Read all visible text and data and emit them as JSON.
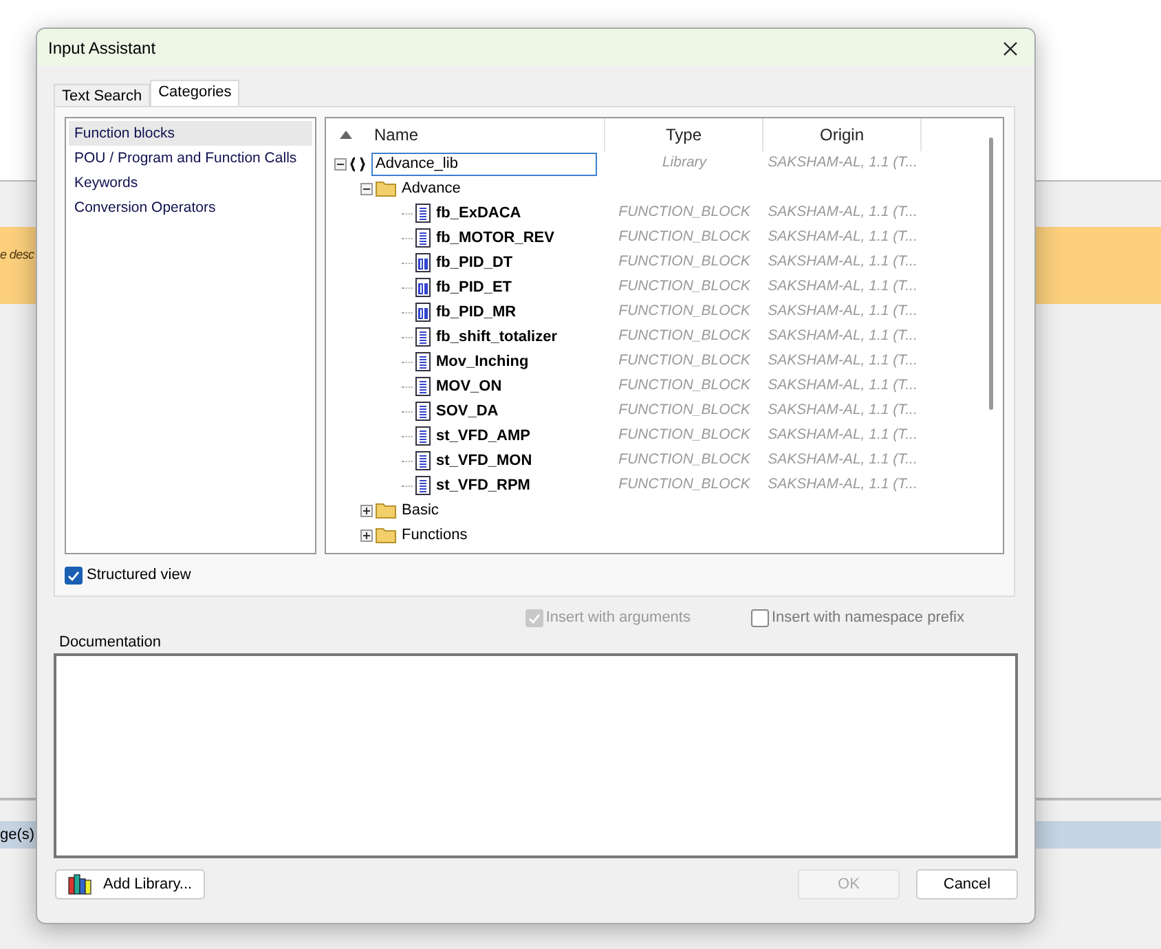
{
  "background": {
    "banner_text": "e desc",
    "status_text": "ge(s)"
  },
  "window": {
    "title": "Input Assistant"
  },
  "tabs": [
    {
      "label": "Text Search",
      "selected": false
    },
    {
      "label": "Categories",
      "selected": true
    }
  ],
  "categories": [
    {
      "label": "Function blocks",
      "selected": true
    },
    {
      "label": "POU / Program and Function Calls",
      "selected": false
    },
    {
      "label": "Keywords",
      "selected": false
    },
    {
      "label": "Conversion Operators",
      "selected": false
    }
  ],
  "tree": {
    "columns": [
      "Name",
      "Type",
      "Origin"
    ],
    "items": [
      {
        "kind": "library",
        "name": "Advance_lib",
        "type": "Library",
        "origin": "SAKSHAM-AL, 1.1 (T...",
        "expanded": true,
        "editing": true,
        "children": [
          {
            "kind": "folder",
            "name": "Advance",
            "expanded": true,
            "children": [
              {
                "kind": "pou",
                "name": "fb_ExDACA",
                "type": "FUNCTION_BLOCK",
                "origin": "SAKSHAM-AL, 1.1 (T..."
              },
              {
                "kind": "pou",
                "name": "fb_MOTOR_REV",
                "type": "FUNCTION_BLOCK",
                "origin": "SAKSHAM-AL, 1.1 (T..."
              },
              {
                "kind": "pou-visual",
                "name": "fb_PID_DT",
                "type": "FUNCTION_BLOCK",
                "origin": "SAKSHAM-AL, 1.1 (T..."
              },
              {
                "kind": "pou-visual",
                "name": "fb_PID_ET",
                "type": "FUNCTION_BLOCK",
                "origin": "SAKSHAM-AL, 1.1 (T..."
              },
              {
                "kind": "pou-visual",
                "name": "fb_PID_MR",
                "type": "FUNCTION_BLOCK",
                "origin": "SAKSHAM-AL, 1.1 (T..."
              },
              {
                "kind": "pou",
                "name": "fb_shift_totalizer",
                "type": "FUNCTION_BLOCK",
                "origin": "SAKSHAM-AL, 1.1 (T..."
              },
              {
                "kind": "pou",
                "name": "Mov_Inching",
                "type": "FUNCTION_BLOCK",
                "origin": "SAKSHAM-AL, 1.1 (T..."
              },
              {
                "kind": "pou",
                "name": "MOV_ON",
                "type": "FUNCTION_BLOCK",
                "origin": "SAKSHAM-AL, 1.1 (T..."
              },
              {
                "kind": "pou",
                "name": "SOV_DA",
                "type": "FUNCTION_BLOCK",
                "origin": "SAKSHAM-AL, 1.1 (T..."
              },
              {
                "kind": "pou",
                "name": "st_VFD_AMP",
                "type": "FUNCTION_BLOCK",
                "origin": "SAKSHAM-AL, 1.1 (T..."
              },
              {
                "kind": "pou",
                "name": "st_VFD_MON",
                "type": "FUNCTION_BLOCK",
                "origin": "SAKSHAM-AL, 1.1 (T..."
              },
              {
                "kind": "pou",
                "name": "st_VFD_RPM",
                "type": "FUNCTION_BLOCK",
                "origin": "SAKSHAM-AL, 1.1 (T..."
              }
            ]
          },
          {
            "kind": "folder",
            "name": "Basic",
            "expanded": false
          },
          {
            "kind": "folder",
            "name": "Functions",
            "expanded": false
          }
        ]
      }
    ]
  },
  "structured_view": {
    "label": "Structured view",
    "checked": true
  },
  "options": [
    {
      "label": "Insert with arguments",
      "checked": true,
      "disabled": true
    },
    {
      "label": "Insert with namespace prefix",
      "checked": false,
      "disabled": false
    }
  ],
  "documentation": {
    "label": "Documentation"
  },
  "buttons": [
    {
      "kind": "library",
      "label": "Add Library...",
      "disabled": false
    },
    {
      "kind": "ok",
      "label": "OK",
      "disabled": true
    },
    {
      "kind": "cancel",
      "label": "Cancel",
      "disabled": false
    }
  ]
}
